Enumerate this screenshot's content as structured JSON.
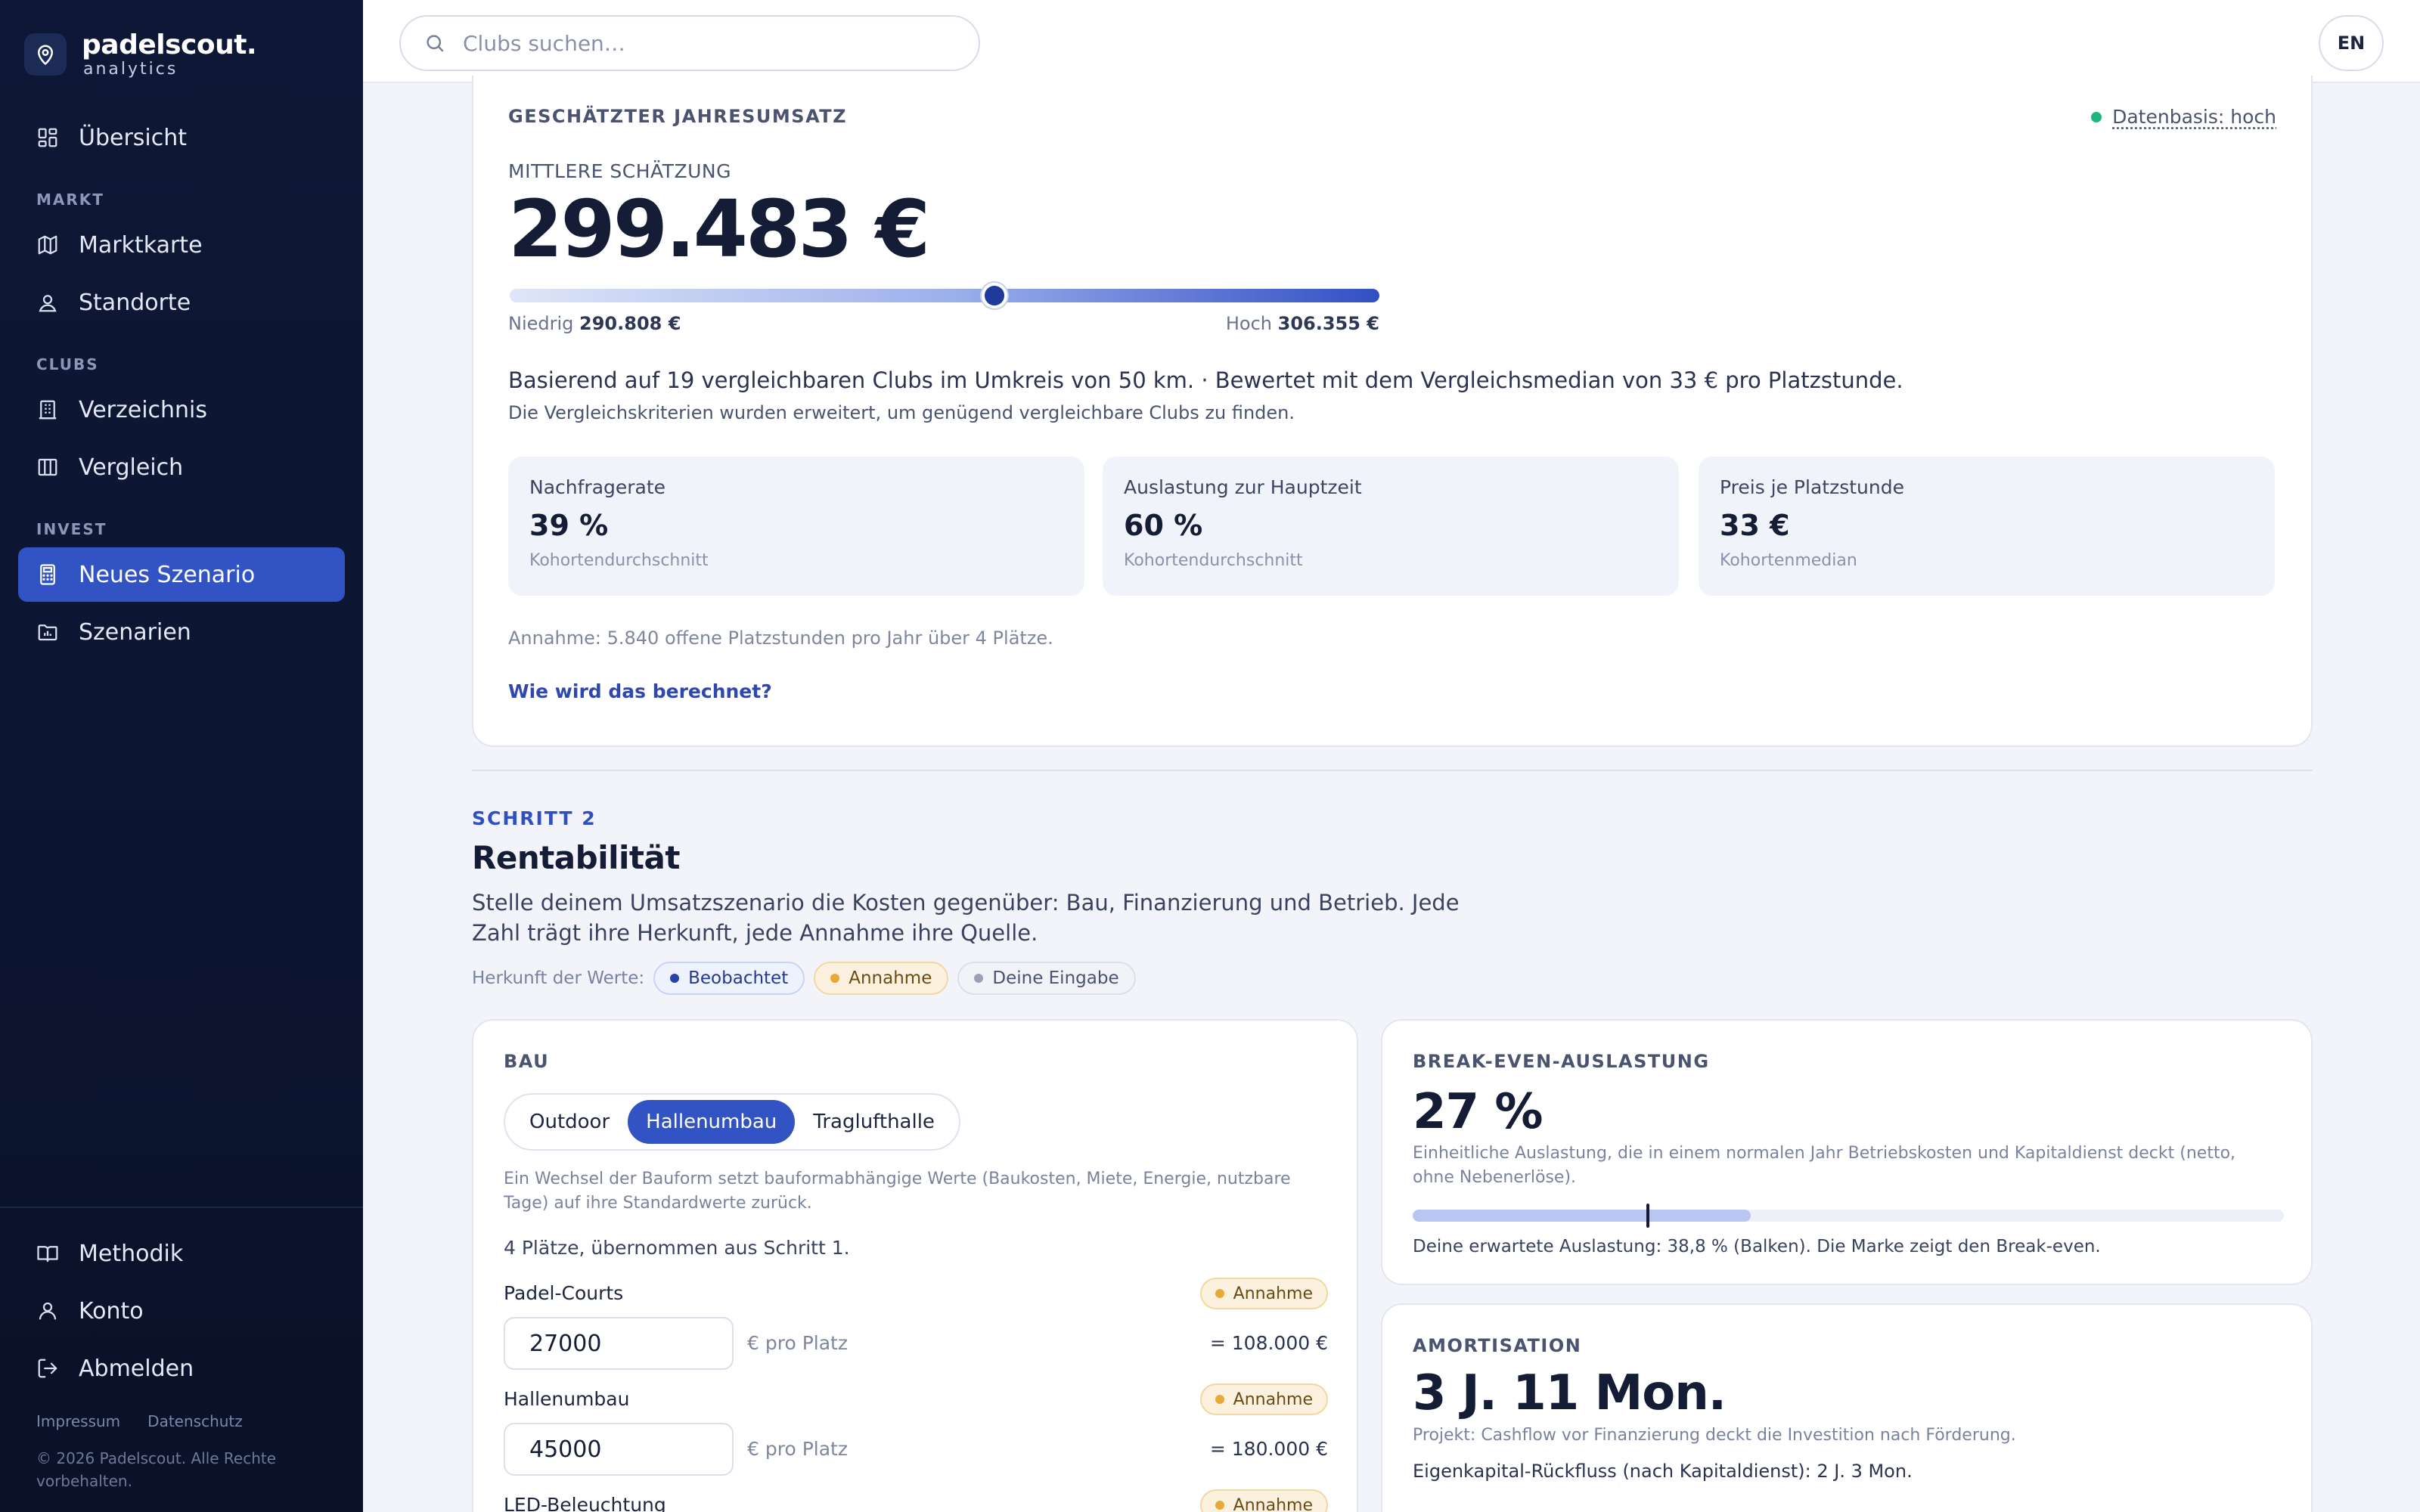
{
  "brand": {
    "name": "padelscout.",
    "sub": "analytics"
  },
  "sidebar": {
    "overview": "Übersicht",
    "section_market": "MARKT",
    "market_map": "Marktkarte",
    "locations": "Standorte",
    "section_clubs": "CLUBS",
    "directory": "Verzeichnis",
    "compare": "Vergleich",
    "section_invest": "INVEST",
    "new_scenario": "Neues Szenario",
    "scenarios": "Szenarien",
    "methodology": "Methodik",
    "account": "Konto",
    "logout": "Abmelden",
    "imprint": "Impressum",
    "privacy": "Datenschutz",
    "copyright": "© 2026 Padelscout. Alle Rechte vorbehalten."
  },
  "topbar": {
    "search_placeholder": "Clubs suchen…",
    "lang": "EN"
  },
  "revenue": {
    "title": "GESCHÄTZTER JAHRESUMSATZ",
    "data_basis": "Datenbasis: hoch",
    "mid_label": "MITTLERE SCHÄTZUNG",
    "mid_value": "299.483 €",
    "low_label": "Niedrig",
    "low_value": "290.808 €",
    "high_label": "Hoch",
    "high_value": "306.355 €",
    "range_position": 0.557,
    "basis": "Basierend auf 19 vergleichbaren Clubs im Umkreis von 50 km. · Bewertet mit dem Vergleichsmedian von 33 € pro Platzstunde.",
    "basis_sub": "Die Vergleichskriterien wurden erweitert, um genügend vergleichbare Clubs zu finden.",
    "metrics": [
      {
        "label": "Nachfragerate",
        "value": "39 %",
        "note": "Kohortendurchschnitt"
      },
      {
        "label": "Auslastung zur Hauptzeit",
        "value": "60 %",
        "note": "Kohortendurchschnitt"
      },
      {
        "label": "Preis je Platzstunde",
        "value": "33 €",
        "note": "Kohortenmedian"
      }
    ],
    "assumption": "Annahme: 5.840 offene Platzstunden pro Jahr über 4 Plätze.",
    "how_link": "Wie wird das berechnet?"
  },
  "step2": {
    "step": "SCHRITT 2",
    "title": "Rentabilität",
    "desc": "Stelle deinem Umsatzszenario die Kosten gegenüber: Bau, Finanzierung und Betrieb. Jede Zahl trägt ihre Herkunft, jede Annahme ihre Quelle.",
    "origin_label": "Herkunft der Werte:",
    "chip_observed": "Beobachtet",
    "chip_assumption": "Annahme",
    "chip_input": "Deine Eingabe"
  },
  "bau": {
    "title": "BAU",
    "options": [
      "Outdoor",
      "Hallenumbau",
      "Traglufthalle"
    ],
    "note": "Ein Wechsel der Bauform setzt bauformabhängige Werte (Baukosten, Miete, Energie, nutzbare Tage) auf ihre Standardwerte zurück.",
    "courts": "4 Plätze, übernommen aus Schritt 1.",
    "fields": [
      {
        "label": "Padel-Courts",
        "value": "27000",
        "unit": "€ pro Platz",
        "total": "= 108.000 €",
        "chip": "Annahme"
      },
      {
        "label": "Hallenumbau",
        "value": "45000",
        "unit": "€ pro Platz",
        "total": "= 180.000 €",
        "chip": "Annahme"
      },
      {
        "label": "LED-Beleuchtung",
        "chip": "Annahme"
      }
    ]
  },
  "breakeven": {
    "title": "BREAK-EVEN-AUSLASTUNG",
    "value": "27 %",
    "desc": "Einheitliche Auslastung, die in einem normalen Jahr Betriebskosten und Kapitaldienst deckt (netto, ohne Nebenerlöse).",
    "expected": 0.388,
    "breakeven": 0.27,
    "caption": "Deine erwartete Auslastung: 38,8 % (Balken). Die Marke zeigt den Break-even."
  },
  "amortisation": {
    "title": "AMORTISATION",
    "value": "3 J. 11 Mon.",
    "desc": "Projekt: Cashflow vor Finanzierung deckt die Investition nach Förderung.",
    "equity": "Eigenkapital-Rückfluss (nach Kapitaldienst): 2 J. 3 Mon."
  }
}
